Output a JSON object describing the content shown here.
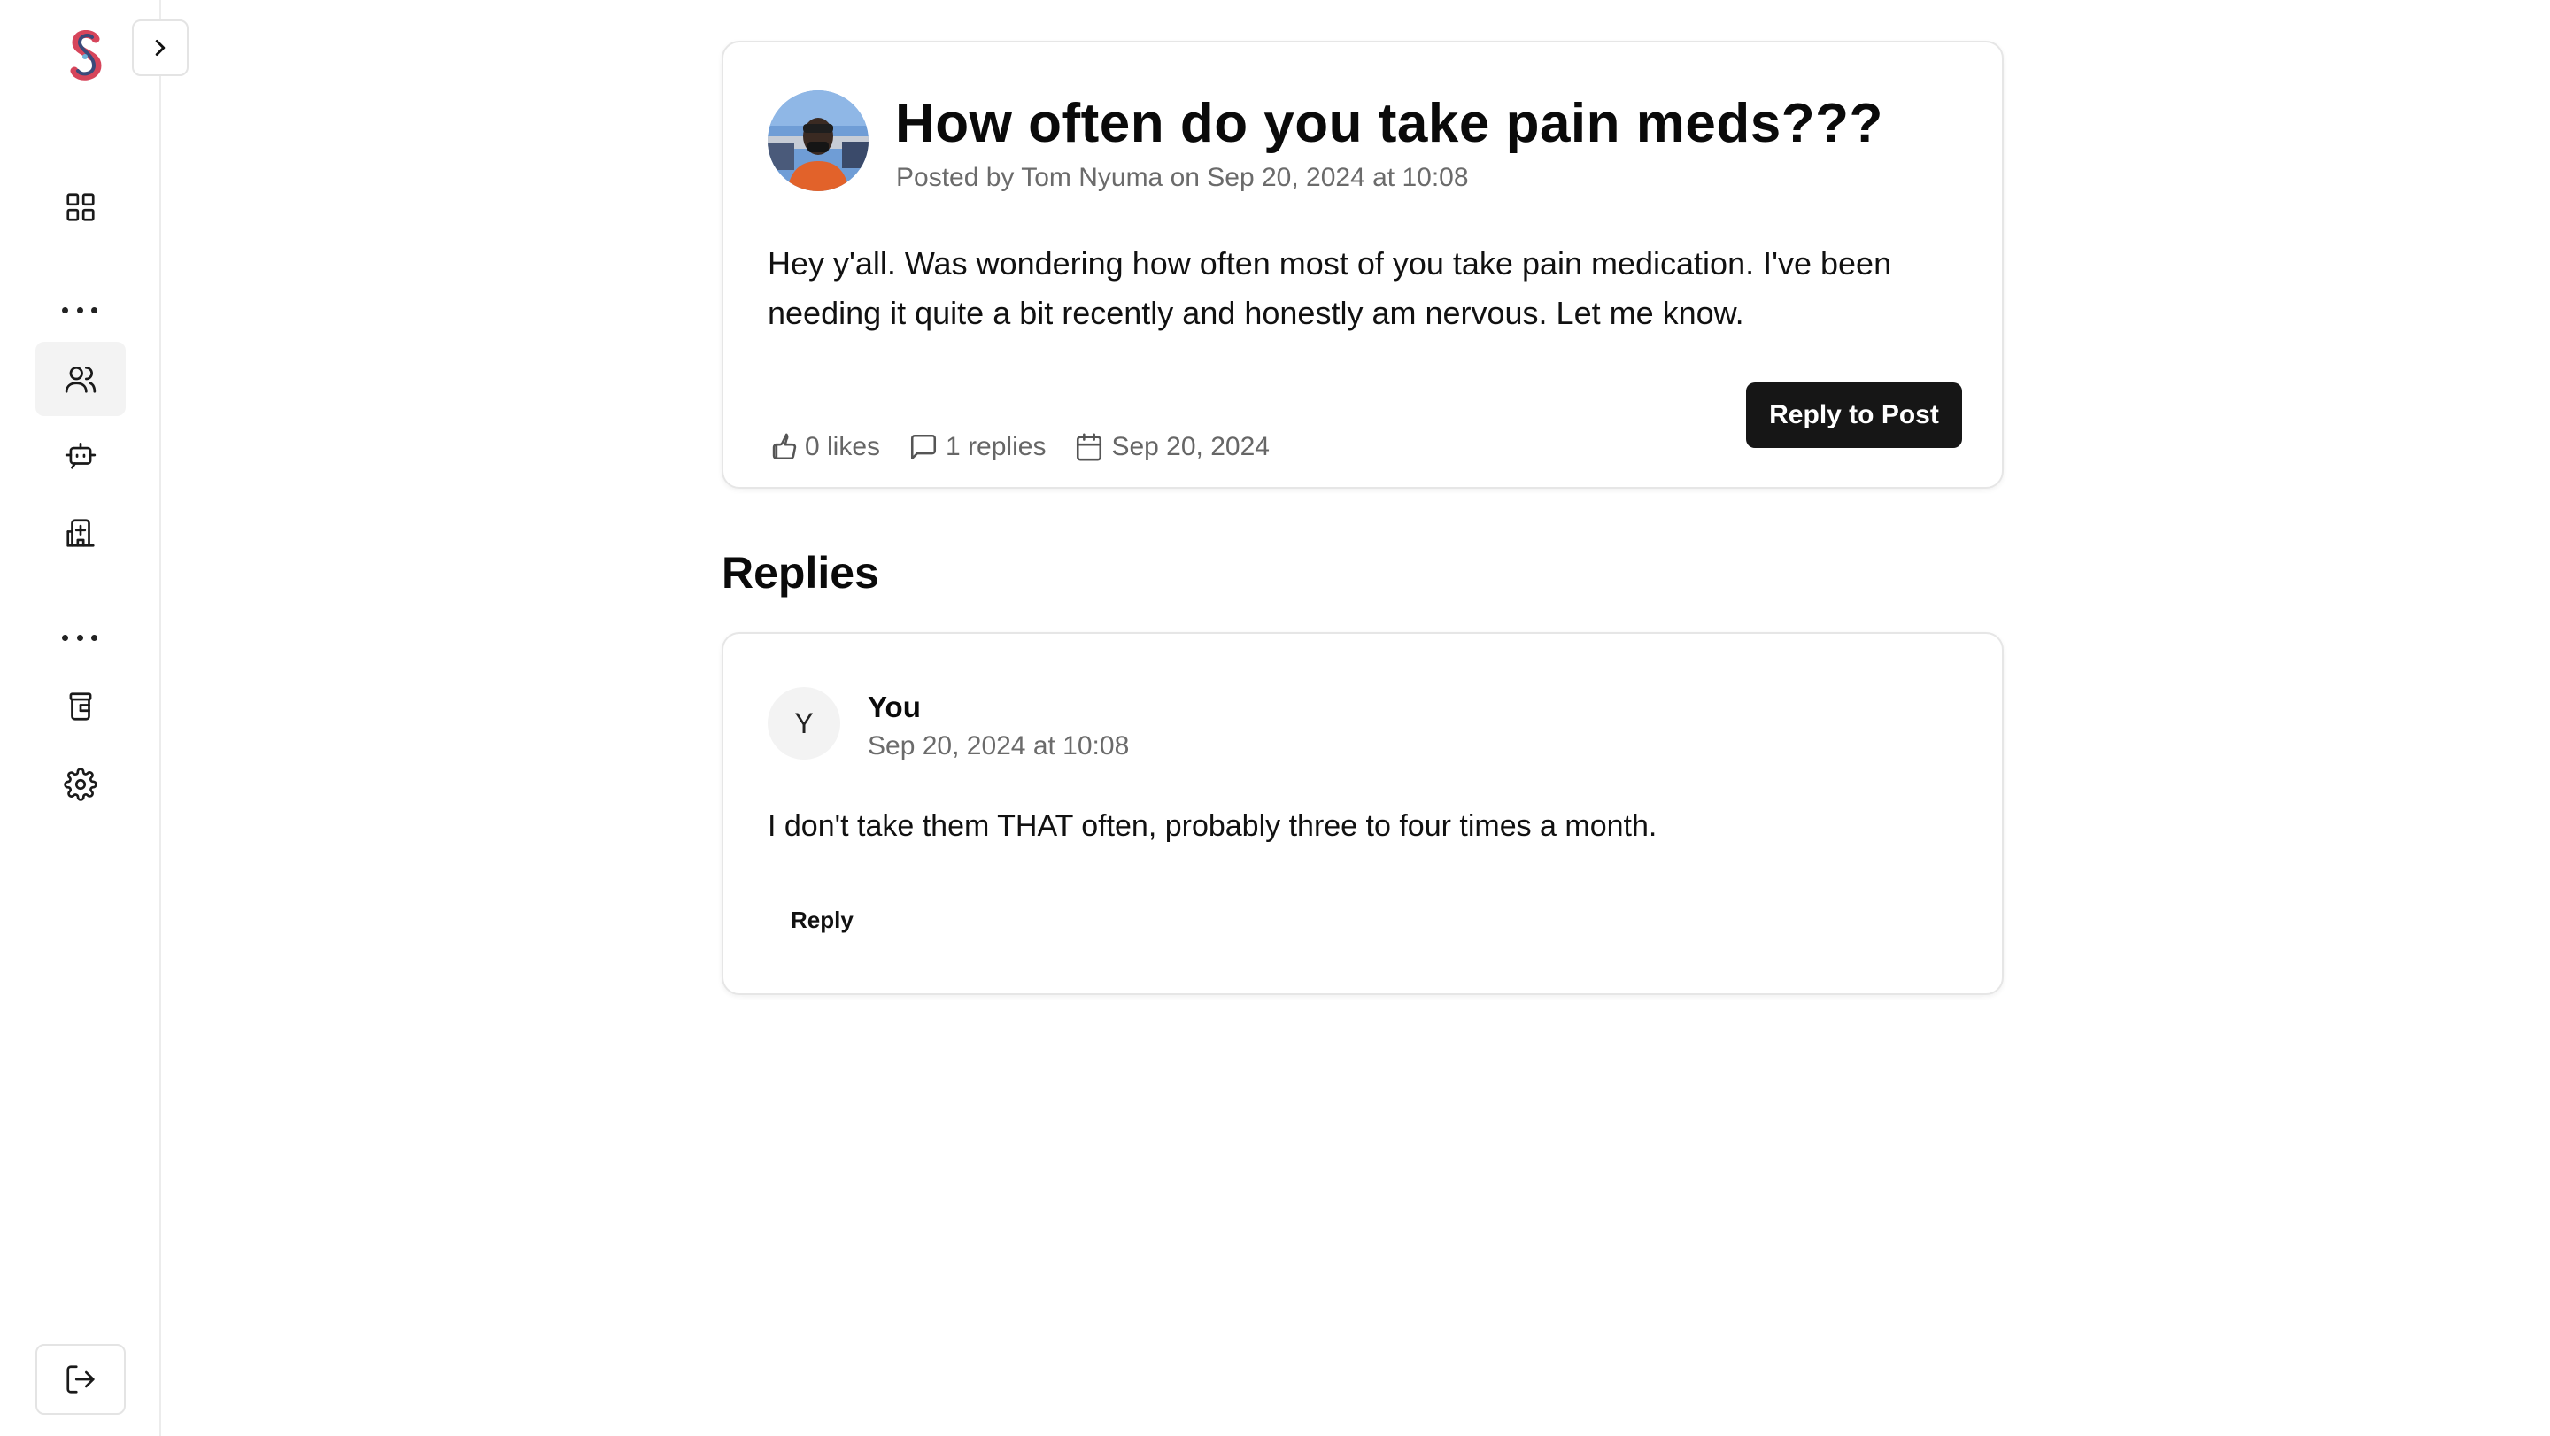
{
  "sidebar": {
    "logo_icon": "app-logo",
    "collapse_icon": "chevron-right-icon",
    "items": [
      {
        "name": "dashboard",
        "icon": "grid-icon",
        "active": false
      },
      {
        "name": "community",
        "icon": "users-icon",
        "active": true
      },
      {
        "name": "assistant",
        "icon": "chat-bot-icon",
        "active": false
      },
      {
        "name": "health",
        "icon": "hospital-icon",
        "active": false
      },
      {
        "name": "pharmacy",
        "icon": "pill-bottle-icon",
        "active": false
      },
      {
        "name": "settings",
        "icon": "gear-icon",
        "active": false
      }
    ],
    "logout_icon": "logout-icon"
  },
  "post": {
    "title": "How often do you take pain meds???",
    "meta": "Posted by Tom Nyuma on Sep 20, 2024 at 10:08",
    "body": "Hey y'all. Was wondering how often most of you take pain medication. I've been needing it quite a bit recently and honestly am nervous. Let me know.",
    "likes": "0 likes",
    "replies": "1 replies",
    "date": "Sep 20, 2024",
    "reply_button": "Reply to Post"
  },
  "replies_section": {
    "heading": "Replies",
    "items": [
      {
        "initial": "Y",
        "author": "You",
        "time": "Sep 20, 2024 at 10:08",
        "body": "I don't take them THAT often, probably three to four times a month.",
        "reply_button": "Reply"
      }
    ]
  },
  "colors": {
    "primary_button": "#161616",
    "muted_text": "#6b6b6b",
    "border": "#e6e6e6"
  }
}
